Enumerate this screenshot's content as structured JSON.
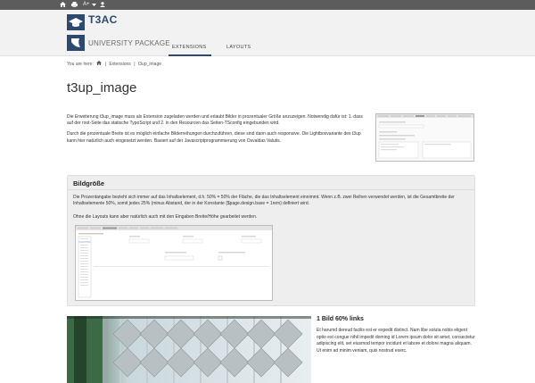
{
  "topbar": {
    "home_icon": "home-icon",
    "print_icon": "print-icon",
    "font_size_label": "A+",
    "font_size_dropdown_icon": "chevron-down-icon",
    "user_icon": "user-icon"
  },
  "header": {
    "logo_title": "T3AC",
    "logo_subtitle": "UNIVERSITY PACKAGE",
    "nav": [
      "EXTENSIONS",
      "LAYOUTS"
    ],
    "nav_active": "EXTENSIONS"
  },
  "breadcrumb": {
    "prefix": "You are here:",
    "home_icon": "home-icon",
    "items": [
      "Extensions",
      "t3up_image"
    ]
  },
  "page": {
    "title": "t3up_image",
    "intro_p1": "Die Erweiterung t3up_image muss als Extension zugeladen werden und erlaubt Bilder in prozentualer Größe anzuzeigen. Notwendig dafür ist: 1. dass auf der root-Seite das statische TypoScript und 2. in den Resourcen das Seiten-TSconfig eingebunden wird.",
    "intro_p2": "Durch die prozentuale Breite ist es möglich einfache Bilderreihungen durchzuführen, diese sind dann auch responsive. Die Lightboxvariante des t3up kann hier natürlich auch eingesetzt werden. Basiert auf der Javascriptprogrammierung von Osvaldas Valutis."
  },
  "box": {
    "heading": "Bildgröße",
    "p1": "Die Prozentangabe bezieht sich immer auf das Inhaltselement, d.h. 50% = 50% der Fläche, die das Inhaltselement einnimmt. Wenn z.B. zwei Reihen verwendet werden, ist die Gesamtbreite der Inhaltselemente 50%, somit jedes 25% (minus Abstand, der in der Konstante {$page.design.base = 1rem} definiert wird.",
    "p2": "Ohne die Layouts kann aber natürlich auch mit den Eingaben Breite/Höhe gearbeitet werden."
  },
  "section2": {
    "heading": "1 Bild 60% links",
    "text": "Et harumd dereud facilis est er expedit distinct. Nam libe soluta nobis eligent optio est congue nihil impedit doming id Lorem ipsum dolor sit amet, consectetur adipiscing elit, set eiusmod tempor incidunt et labore et dolore magna aliquam. Ut enim ad minim veniam, quis nostrud exerc."
  },
  "colors": {
    "brand": "#2d4a6e",
    "topbar": "#5c5c5c",
    "header_bg": "#f2f2f2",
    "box_bg": "#eeeeee"
  }
}
